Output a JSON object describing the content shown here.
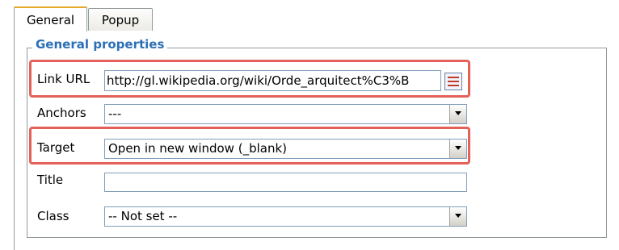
{
  "tabs": [
    {
      "label": "General"
    },
    {
      "label": "Popup"
    }
  ],
  "section": {
    "legend": "General properties"
  },
  "fields": {
    "link_url": {
      "label": "Link URL",
      "value": "http://gl.wikipedia.org/wiki/Orde_arquitect%C3%B"
    },
    "anchors": {
      "label": "Anchors",
      "value": "---"
    },
    "target": {
      "label": "Target",
      "value": "Open in new window (_blank)"
    },
    "title": {
      "label": "Title",
      "value": ""
    },
    "class": {
      "label": "Class",
      "value": "-- Not set --"
    }
  },
  "colors": {
    "highlight": "#e4615a",
    "legend": "#2b6fb6",
    "active_tab_accent": "#e6a82a"
  },
  "icons": {
    "browse": "link-browser-icon",
    "dropdown": "chevron-down-icon"
  }
}
